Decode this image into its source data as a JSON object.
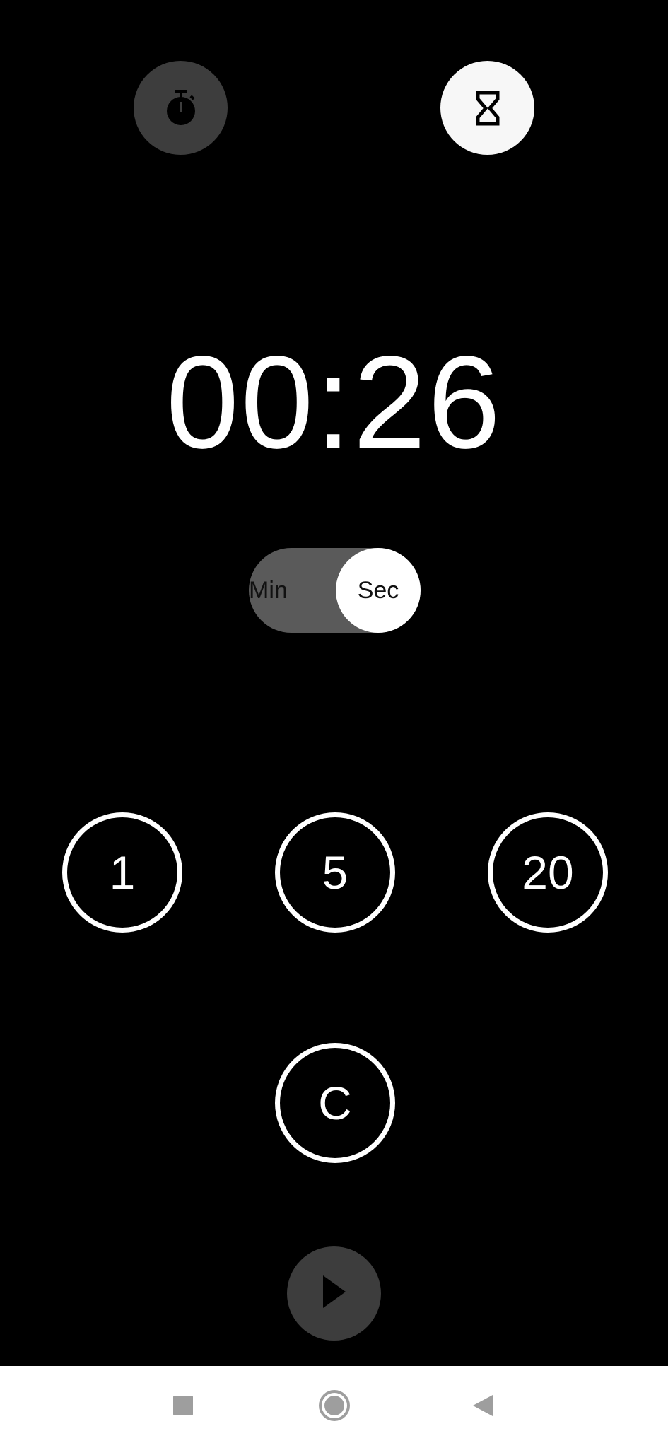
{
  "modes": {
    "stopwatch_icon": "stopwatch-icon",
    "timer_icon": "hourglass-icon",
    "active": "timer"
  },
  "display": {
    "time": "00:26"
  },
  "unit_toggle": {
    "min_label": "Min",
    "sec_label": "Sec",
    "selected": "Sec"
  },
  "presets": {
    "one": "1",
    "five": "5",
    "twenty": "20",
    "clear": "C"
  },
  "controls": {
    "play_icon": "play-icon"
  },
  "nav": {
    "recents_icon": "square-icon",
    "home_icon": "circle-icon",
    "back_icon": "triangle-back-icon"
  },
  "colors": {
    "background": "#000000",
    "active_mode_bg": "#f7f7f7",
    "inactive_mode_bg": "#3d3d3d",
    "toggle_track": "#5a5a5a",
    "foreground": "#ffffff",
    "nav_bar": "#ffffff",
    "nav_icon": "#9e9e9e"
  }
}
